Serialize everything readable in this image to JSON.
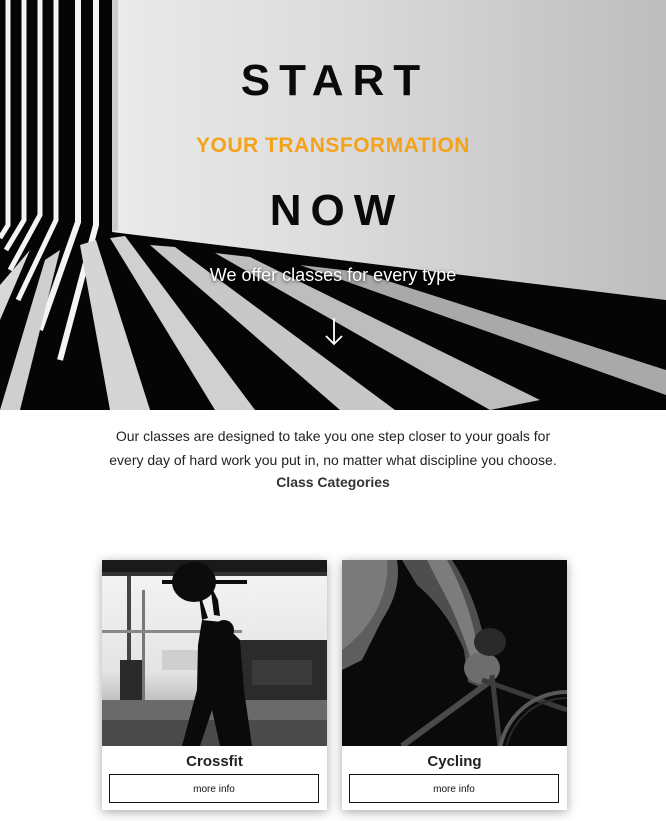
{
  "hero": {
    "title_line1": "START",
    "title_line2": "YOUR TRANSFORMATION",
    "title_line3": "NOW",
    "tagline": "We offer classes for every type",
    "scroll_icon": "arrow-down-icon",
    "accent_color": "#f5a21b"
  },
  "intro": {
    "line1": "Our classes are designed to take you one step closer to your goals for",
    "line2": "every day of hard work you put in, no matter what discipline you choose.",
    "heading": "Class Categories"
  },
  "cards": [
    {
      "name": "Crossfit",
      "button": "more info"
    },
    {
      "name": "Cycling",
      "button": "more info"
    }
  ]
}
